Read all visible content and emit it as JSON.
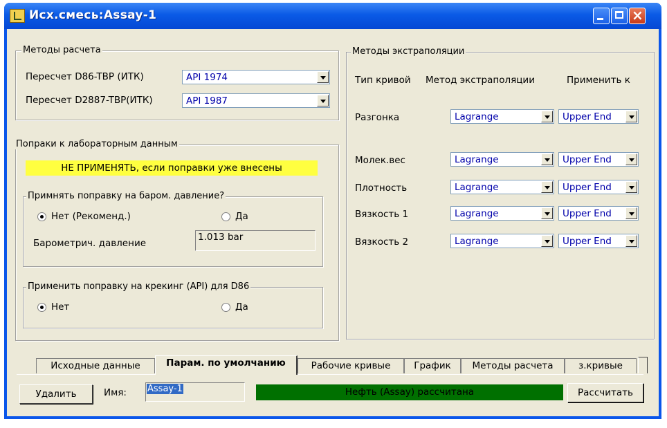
{
  "window": {
    "title": "Исх.смесь:Assay-1"
  },
  "calc_methods": {
    "legend": "Методы расчета",
    "rows": [
      {
        "label": "Пересчет D86-TBP (ИТК)",
        "value": "API 1974"
      },
      {
        "label": "Пересчет D2887-TBP(ИТК)",
        "value": "API 1987"
      }
    ]
  },
  "lab_corrections": {
    "legend": "Попраки к лабораторным данным",
    "banner": "НЕ ПРИМЕНЯТЬ, если поправки уже внесены",
    "baro": {
      "legend": "Примнять поправку на баром. давление?",
      "option_no": "Нет (Рекоменд.)",
      "option_yes": "Да",
      "pressure_label": "Барометрич. давление",
      "pressure_value": "1.013 bar"
    },
    "cracking": {
      "legend": "Применить поправку на крекинг (API) для D86",
      "option_no": "Нет",
      "option_yes": "Да"
    }
  },
  "extrapolation": {
    "legend": "Методы экстраполяции",
    "col_curve": "Тип кривой",
    "col_method": "Метод экстраполяции",
    "col_apply": "Применить к",
    "rows": [
      {
        "curve": "Разгонка",
        "method": "Lagrange",
        "apply": "Upper End"
      },
      {
        "curve": "Молек.вес",
        "method": "Lagrange",
        "apply": "Upper End"
      },
      {
        "curve": "Плотность",
        "method": "Lagrange",
        "apply": "Upper End"
      },
      {
        "curve": "Вязкость 1",
        "method": "Lagrange",
        "apply": "Upper End"
      },
      {
        "curve": "Вязкость 2",
        "method": "Lagrange",
        "apply": "Upper End"
      }
    ]
  },
  "tabs": [
    "Исходные данные",
    "Парам. по умолчанию",
    "Рабочие кривые",
    "График",
    "Методы расчета",
    "з.кривые"
  ],
  "active_tab": "Парам. по умолчанию",
  "bottom": {
    "delete_label": "Удалить",
    "name_label": "Имя:",
    "name_value": "Assay-1",
    "status": "Нефть (Assay) рассчитана",
    "calculate_label": "Рассчитать"
  },
  "colors": {
    "banner": "#ffff40",
    "status": "#007000",
    "selection": "#316ac5"
  }
}
